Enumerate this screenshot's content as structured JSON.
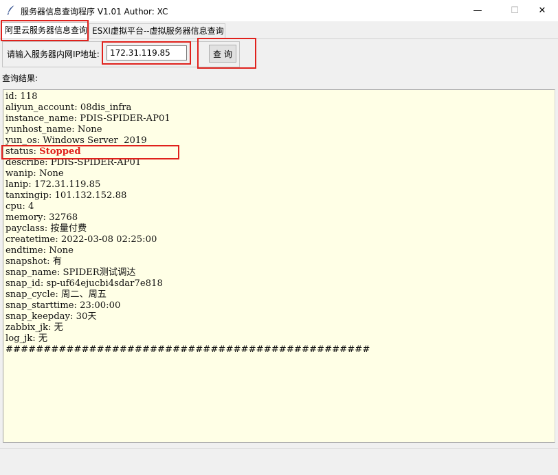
{
  "window": {
    "title": "服务器信息查询程序 V1.01 Author: XC",
    "minimize_glyph": "—",
    "maximize_glyph": "☐",
    "close_glyph": "✕"
  },
  "tabs": [
    {
      "label": "阿里云服务器信息查询",
      "active": true
    },
    {
      "label": "ESXI虚拟平台--虚拟服务器信息查询",
      "active": false
    }
  ],
  "query": {
    "ip_label": "请输入服务器内网IP地址:",
    "ip_value": "172.31.119.85",
    "button_label": "查询"
  },
  "result": {
    "label": "查询结果:",
    "lines": [
      "id: 118",
      "aliyun_account: 08dis_infra",
      "instance_name: PDIS-SPIDER-AP01",
      "yunhost_name: None",
      "yun_os: Windows Server  2019",
      "status: ",
      "describe: PDIS-SPIDER-AP01",
      "wanip: None",
      "lanip: 172.31.119.85",
      "tanxingip: 101.132.152.88",
      "cpu: 4",
      "memory: 32768",
      "payclass: 按量付费",
      "createtime: 2022-03-08 02:25:00",
      "endtime: None",
      "snapshot: 有",
      "snap_name: SPIDER测试调达",
      "snap_id: sp-uf64ejucbi4sdar7e818",
      "snap_cycle: 周二、周五",
      "snap_starttime: 23:00:00",
      "snap_keepday: 30天",
      "zabbix_jk: 无",
      "log_jk: 无",
      "################################################"
    ],
    "status_value": "Stopped",
    "status_color": "#e0211c",
    "background": "#ffffe6"
  },
  "highlight_color": "#e0211c"
}
